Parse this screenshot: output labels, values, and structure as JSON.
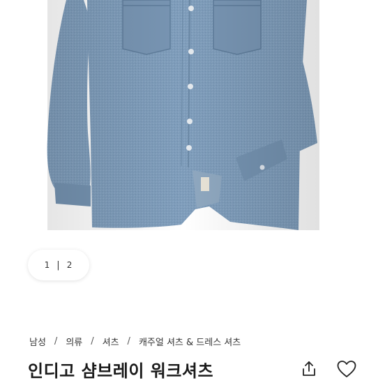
{
  "gallery": {
    "current_page": "1",
    "total_pages": "2",
    "image_alt": "indigo chambray work shirt"
  },
  "breadcrumb": {
    "items": [
      "남성",
      "의류",
      "셔츠",
      "캐주얼 셔츠 & 드레스 셔츠"
    ],
    "separator": "/"
  },
  "product": {
    "title": "인디고 샴브레이 워크셔츠"
  },
  "icons": {
    "share": "share-icon",
    "like": "heart-icon"
  }
}
